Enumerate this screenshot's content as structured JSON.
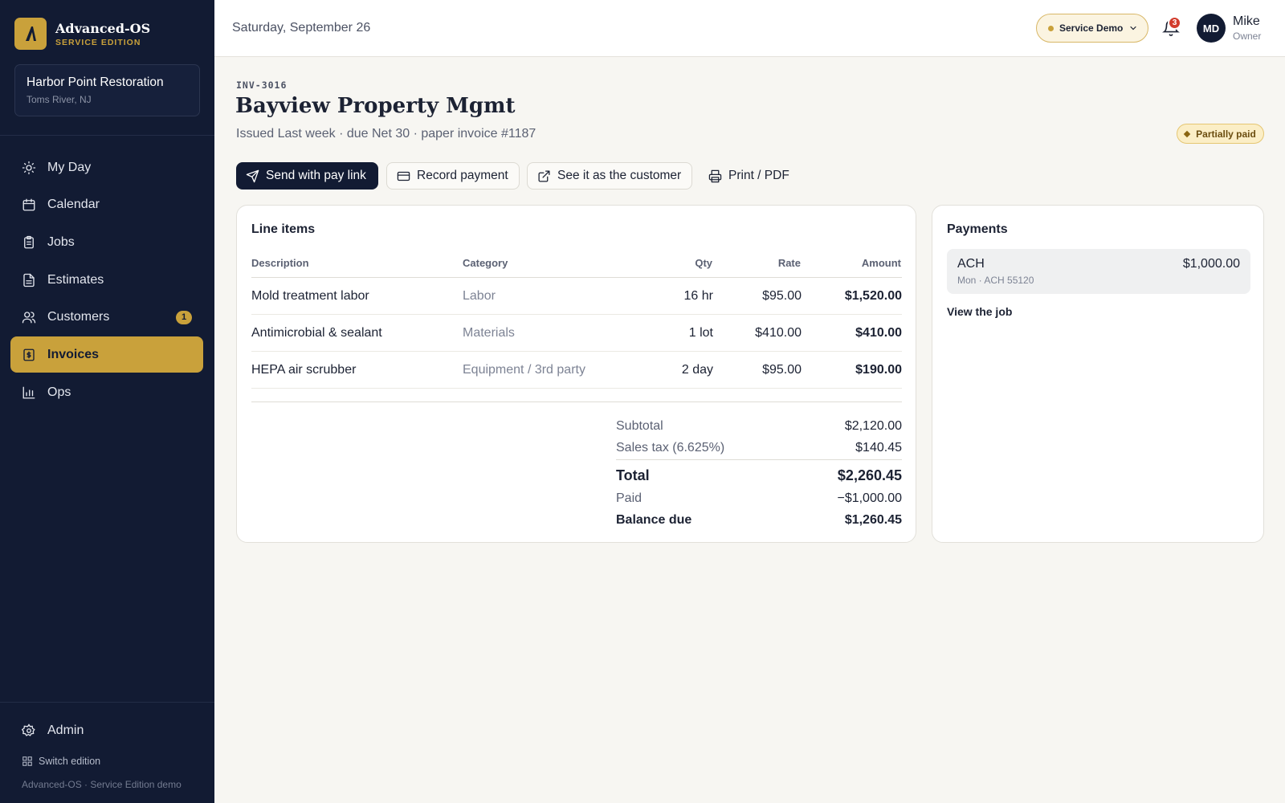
{
  "brand": {
    "name": "Advanced-OS",
    "edition": "SERVICE EDITION"
  },
  "org": {
    "name": "Harbor Point Restoration",
    "location": "Toms River, NJ"
  },
  "nav": {
    "items": [
      {
        "label": "My Day",
        "icon": "sun-icon"
      },
      {
        "label": "Calendar",
        "icon": "calendar-icon"
      },
      {
        "label": "Jobs",
        "icon": "clipboard-icon"
      },
      {
        "label": "Estimates",
        "icon": "file-icon"
      },
      {
        "label": "Customers",
        "icon": "users-icon",
        "badge": "1"
      },
      {
        "label": "Invoices",
        "icon": "receipt-icon",
        "active": true
      },
      {
        "label": "Ops",
        "icon": "bar-chart-icon"
      }
    ],
    "admin": "Admin",
    "switch_edition": "Switch edition",
    "footer": "Advanced-OS · Service Edition demo"
  },
  "header": {
    "date": "Saturday, September 26",
    "demo_label": "Service Demo",
    "notification_count": "3",
    "user": {
      "initials": "MD",
      "name": "Mike",
      "role": "Owner"
    }
  },
  "invoice": {
    "id": "INV-3016",
    "customer": "Bayview Property Mgmt",
    "meta": "Issued Last week · due Net 30 · paper invoice #1187",
    "status": "Partially paid",
    "actions": {
      "send": "Send with pay link",
      "record": "Record payment",
      "see": "See it as the customer",
      "print": "Print / PDF"
    }
  },
  "line_items": {
    "title": "Line items",
    "columns": [
      "Description",
      "Category",
      "Qty",
      "Rate",
      "Amount"
    ],
    "rows": [
      {
        "description": "Mold treatment labor",
        "category": "Labor",
        "qty": "16 hr",
        "rate": "$95.00",
        "amount": "$1,520.00"
      },
      {
        "description": "Antimicrobial & sealant",
        "category": "Materials",
        "qty": "1 lot",
        "rate": "$410.00",
        "amount": "$410.00"
      },
      {
        "description": "HEPA air scrubber",
        "category": "Equipment / 3rd party",
        "qty": "2 day",
        "rate": "$95.00",
        "amount": "$190.00"
      }
    ],
    "summary": {
      "subtotal_label": "Subtotal",
      "subtotal": "$2,120.00",
      "tax_label": "Sales tax (6.625%)",
      "tax": "$140.45",
      "total_label": "Total",
      "total": "$2,260.45",
      "paid_label": "Paid",
      "paid": "−$1,000.00",
      "balance_label": "Balance due",
      "balance": "$1,260.45"
    }
  },
  "payments": {
    "title": "Payments",
    "items": [
      {
        "method": "ACH",
        "detail": "Mon · ACH 55120",
        "amount": "$1,000.00"
      }
    ],
    "view_job": "View the job"
  },
  "colors": {
    "sidebar": "#121b33",
    "accent": "#c9a13b",
    "background": "#f7f6f2",
    "alert": "#d23c2c"
  }
}
